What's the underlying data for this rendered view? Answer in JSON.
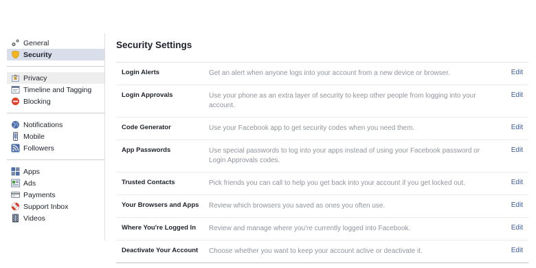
{
  "sidebar": {
    "groups": [
      [
        {
          "label": "General",
          "icon": "gears-icon"
        },
        {
          "label": "Security",
          "icon": "shield-icon",
          "selected": true
        }
      ],
      [
        {
          "label": "Privacy",
          "icon": "padlock-icon"
        },
        {
          "label": "Timeline and Tagging",
          "icon": "timeline-icon"
        },
        {
          "label": "Blocking",
          "icon": "blocking-icon"
        }
      ],
      [
        {
          "label": "Notifications",
          "icon": "globe-icon"
        },
        {
          "label": "Mobile",
          "icon": "mobile-icon"
        },
        {
          "label": "Followers",
          "icon": "rss-icon"
        }
      ],
      [
        {
          "label": "Apps",
          "icon": "apps-icon"
        },
        {
          "label": "Ads",
          "icon": "ads-icon"
        },
        {
          "label": "Payments",
          "icon": "credit-card-icon"
        },
        {
          "label": "Support Inbox",
          "icon": "lifebuoy-icon"
        },
        {
          "label": "Videos",
          "icon": "film-icon"
        }
      ]
    ]
  },
  "main": {
    "title": "Security Settings",
    "edit_label": "Edit",
    "rows": [
      {
        "label": "Login Alerts",
        "desc": "Get an alert when anyone logs into your account from a new device or browser."
      },
      {
        "label": "Login Approvals",
        "desc": "Use your phone as an extra layer of security to keep other people from logging into your account."
      },
      {
        "label": "Code Generator",
        "desc": "Use your Facebook app to get security codes when you need them."
      },
      {
        "label": "App Passwords",
        "desc": "Use special passwords to log into your apps instead of using your Facebook password or Login Approvals codes."
      },
      {
        "label": "Trusted Contacts",
        "desc": "Pick friends you can call to help you get back into your account if you get locked out."
      },
      {
        "label": "Your Browsers and Apps",
        "desc": "Review which browsers you saved as ones you often use."
      },
      {
        "label": "Where You're Logged In",
        "desc": "Review and manage where you're currently logged into Facebook."
      },
      {
        "label": "Deactivate Your Account",
        "desc": "Choose whether you want to keep your account active or deactivate it."
      }
    ]
  },
  "colors": {
    "link": "#365899",
    "selected_bg": "#d8dfea",
    "muted_text": "#90949c"
  }
}
